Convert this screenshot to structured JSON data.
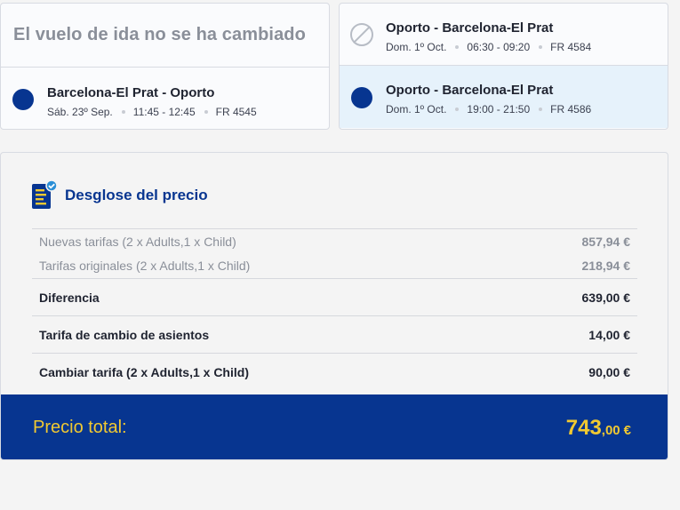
{
  "outbound": {
    "header": "El vuelo de ida no se ha cambiado",
    "flight": {
      "route": "Barcelona-El Prat - Oporto",
      "date": "Sáb. 23º Sep.",
      "time": "11:45 - 12:45",
      "flight_no": "FR 4545"
    }
  },
  "return": {
    "flights": [
      {
        "route": "Oporto - Barcelona-El Prat",
        "date": "Dom. 1º Oct.",
        "time": "06:30 - 09:20",
        "flight_no": "FR 4584",
        "state": "unavailable"
      },
      {
        "route": "Oporto - Barcelona-El Prat",
        "date": "Dom. 1º Oct.",
        "time": "19:00 - 21:50",
        "flight_no": "FR 4586",
        "state": "selected"
      }
    ]
  },
  "price_breakdown": {
    "title": "Desglose del precio",
    "icon": "document-check-icon",
    "lines": [
      {
        "label": "Nuevas tarifas (2 x Adults,1 x Child)",
        "amount": "857,94 €"
      },
      {
        "label": "Tarifas originales (2 x Adults,1 x Child)",
        "amount": "218,94 €"
      },
      {
        "label": "Diferencia",
        "amount": "639,00 €"
      },
      {
        "label": "Tarifa de cambio de asientos",
        "amount": "14,00 €"
      },
      {
        "label": "Cambiar tarifa (2 x Adults,1 x Child)",
        "amount": "90,00 €"
      }
    ],
    "total": {
      "label": "Precio total:",
      "integer": "743",
      "decimals": ",00",
      "currency": "€"
    }
  },
  "colors": {
    "brand_blue": "#073590",
    "accent_yellow": "#f1c931",
    "selected_bg": "#e6f2fb"
  }
}
